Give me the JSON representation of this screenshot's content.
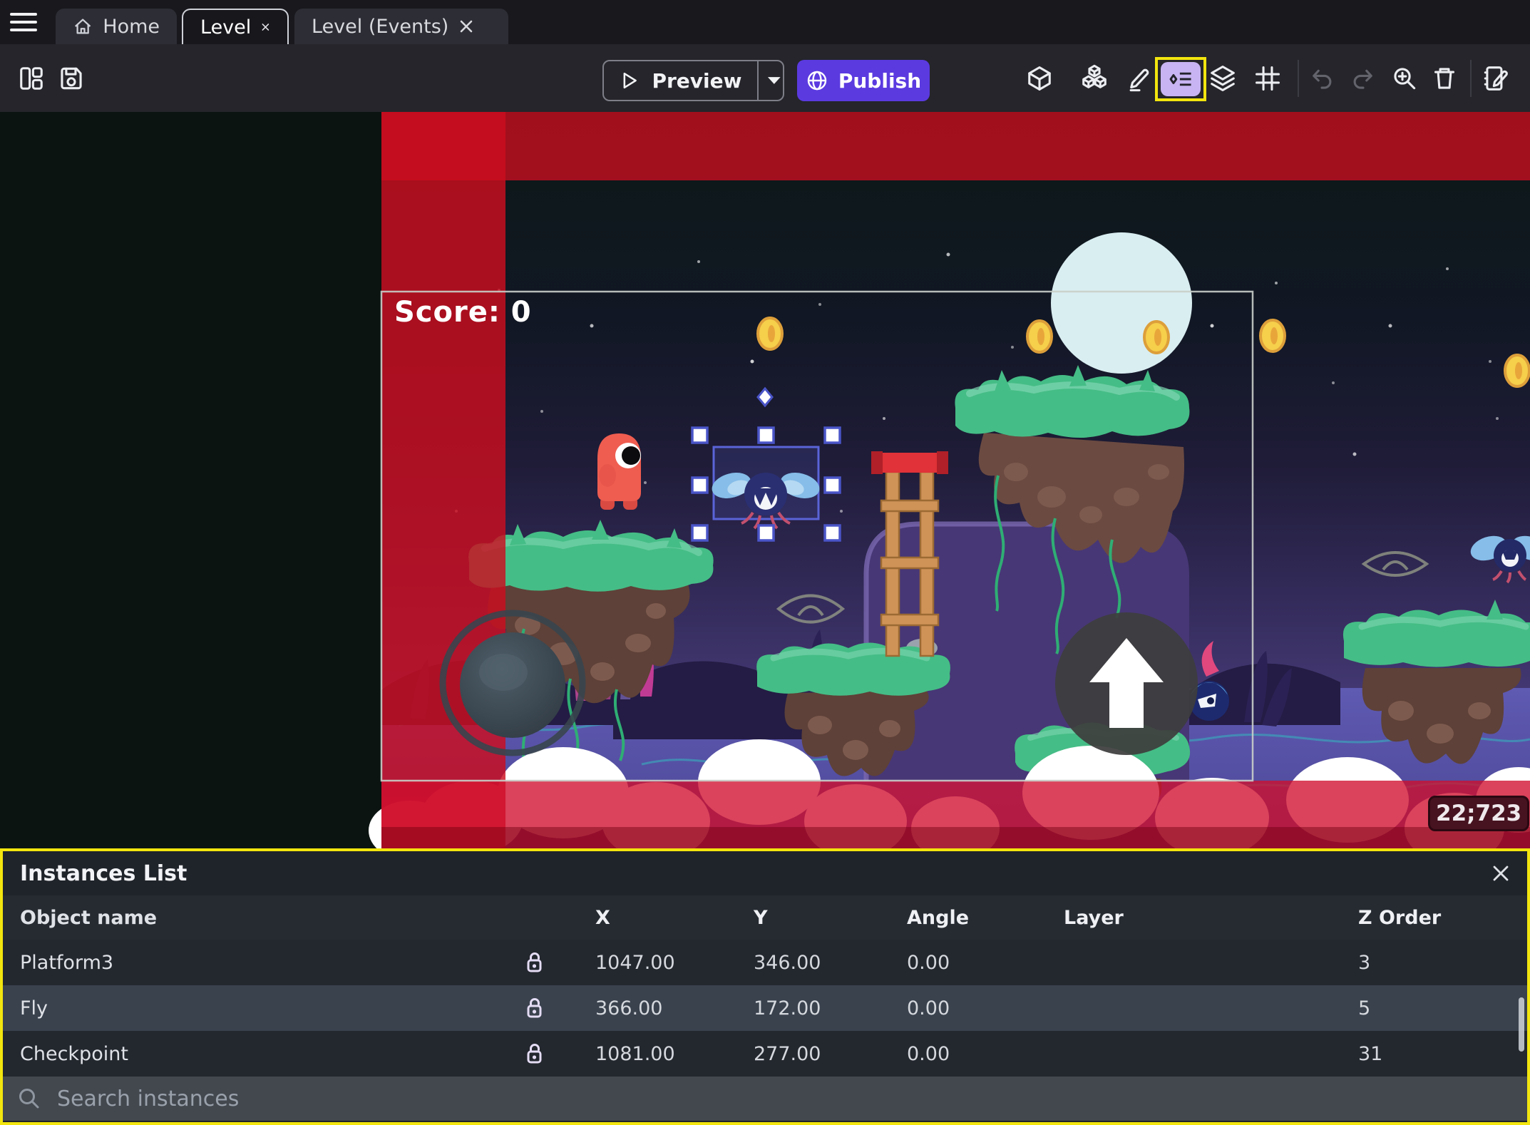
{
  "window": {
    "tabs": [
      {
        "label": "Home"
      },
      {
        "label": "Level",
        "active": true,
        "closable": true
      },
      {
        "label": "Level (Events)",
        "closable": true
      }
    ]
  },
  "toolbar": {
    "preview_label": "Preview",
    "publish_label": "Publish",
    "right_icons": [
      "objects",
      "object-groups",
      "edit",
      "instances-list",
      "layers",
      "grid",
      "undo",
      "redo",
      "zoom-in",
      "delete",
      "edit-scene-properties"
    ],
    "highlighted_icon": "instances-list"
  },
  "scene": {
    "score_text": "Score: 0",
    "coords_badge": "22;723",
    "selected_instance": "Fly"
  },
  "panel": {
    "title": "Instances List",
    "columns": [
      "Object name",
      "X",
      "Y",
      "Angle",
      "Layer",
      "Z Order"
    ],
    "rows": [
      {
        "name": "Platform3",
        "x": "1047.00",
        "y": "346.00",
        "angle": "0.00",
        "layer": "",
        "z": "3"
      },
      {
        "name": "Fly",
        "x": "366.00",
        "y": "172.00",
        "angle": "0.00",
        "layer": "",
        "z": "5",
        "selected": true
      },
      {
        "name": "Checkpoint",
        "x": "1081.00",
        "y": "277.00",
        "angle": "0.00",
        "layer": "",
        "z": "31"
      }
    ],
    "search_placeholder": "Search instances"
  },
  "colors": {
    "publish_purple": "#5b3ae0",
    "highlight_yellow": "#f2e50e",
    "selection_blue": "#5a64d8",
    "overlay_red": "#cc0d1f",
    "panel_row_selected": "#3a424e"
  }
}
